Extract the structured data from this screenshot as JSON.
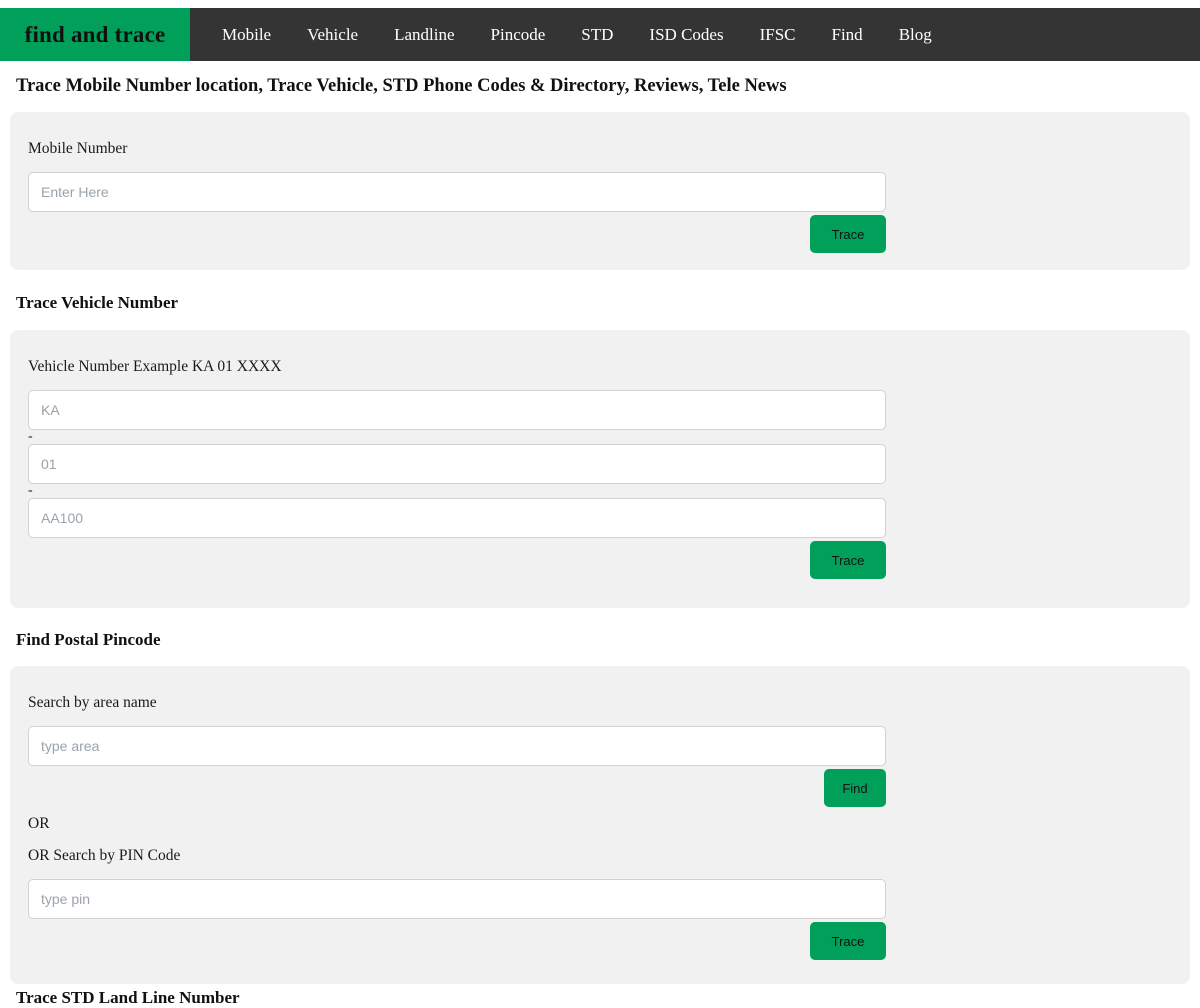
{
  "brand": {
    "label": "find and trace"
  },
  "nav": {
    "items": [
      {
        "label": "Mobile"
      },
      {
        "label": "Vehicle"
      },
      {
        "label": "Landline"
      },
      {
        "label": "Pincode"
      },
      {
        "label": "STD"
      },
      {
        "label": "ISD Codes"
      },
      {
        "label": "IFSC"
      },
      {
        "label": "Find"
      },
      {
        "label": "Blog"
      }
    ]
  },
  "page": {
    "title": "Trace Mobile Number location, Trace Vehicle, STD Phone Codes & Directory, Reviews, Tele News"
  },
  "mobile_section": {
    "label": "Mobile Number",
    "input_placeholder": "Enter Here",
    "button_label": "Trace"
  },
  "vehicle_section": {
    "heading": "Trace Vehicle Number",
    "label": "Vehicle Number Example KA 01 XXXX",
    "state_placeholder": "KA",
    "district_placeholder": "01",
    "series_placeholder": "AA100",
    "separator": "-",
    "button_label": "Trace"
  },
  "pincode_section": {
    "heading": "Find Postal Pincode",
    "area_label": "Search by area name",
    "area_placeholder": "type area",
    "find_button_label": "Find",
    "or_label": "OR",
    "pin_label": "OR Search by PIN Code",
    "pin_placeholder": "type pin",
    "trace_button_label": "Trace"
  },
  "std_section": {
    "heading": "Trace STD Land Line Number"
  },
  "colors": {
    "brand_green": "#00a05a",
    "navbar_dark": "#343434",
    "panel_gray": "#f1f1f1"
  }
}
